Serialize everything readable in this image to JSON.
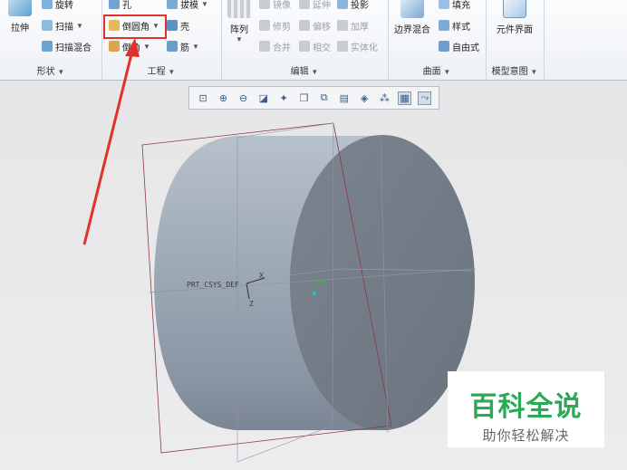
{
  "ribbon": {
    "shape": {
      "title": "形状",
      "extrude": "拉伸",
      "revolve": "旋转",
      "sweep": "扫描",
      "swept_blend": "扫描混合"
    },
    "engineering": {
      "title": "工程",
      "hole": "孔",
      "draft": "拔模",
      "round": "倒圆角",
      "shell": "壳",
      "chamfer": "倒角",
      "rib": "筋"
    },
    "editing": {
      "title": "编辑",
      "pattern": "阵列",
      "mirror": "镜像",
      "extend": "延伸",
      "project": "投影",
      "trim": "修剪",
      "offset": "偏移",
      "thicken": "加厚",
      "merge": "合并",
      "intersect": "相交",
      "solidify": "实体化"
    },
    "surfaces": {
      "title": "曲面",
      "boundary_blend": "边界混合",
      "fill": "填充",
      "style": "样式",
      "freestyle": "自由式"
    },
    "model_intent": {
      "title": "模型意图",
      "component_interface": "元件界面"
    }
  },
  "model": {
    "csys_label": "PRT_CSYS_DEF",
    "axis_x": "X",
    "axis_z": "Z"
  },
  "watermark": {
    "line1": "百科全说",
    "line2": "助你轻松解决"
  },
  "colors": {
    "highlight": "#e0312a",
    "arrow": "#e0312a",
    "brand_green": "#2aaa54"
  }
}
